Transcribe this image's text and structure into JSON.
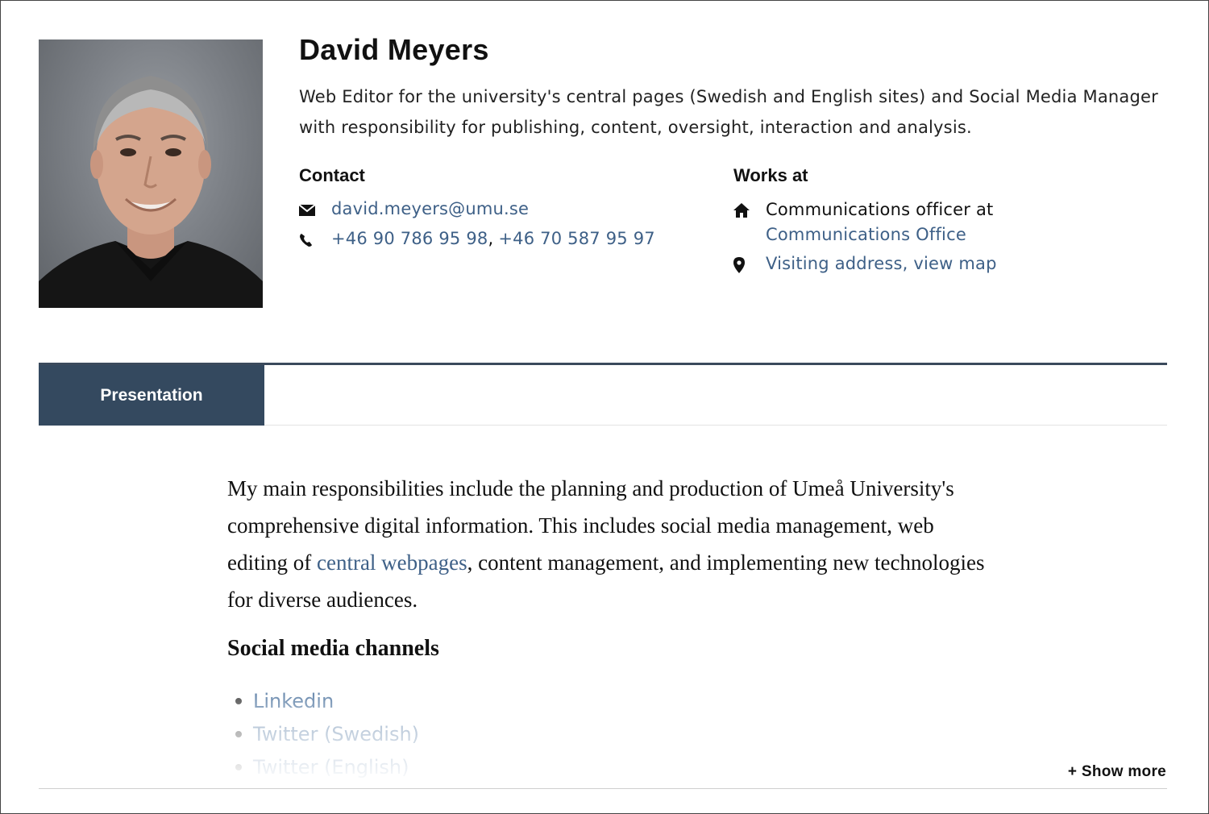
{
  "profile": {
    "name": "David Meyers",
    "role": "Web Editor for the university's central pages (Swedish and English sites) and Social Media Manager with responsibility for publishing, content, oversight, interaction and analysis.",
    "photo_icon": "portrait-photo"
  },
  "contact": {
    "heading": "Contact",
    "email": "david.meyers@umu.se",
    "email_icon": "envelope-icon",
    "phone_1": "+46 90 786 95 98",
    "phone_sep": ",",
    "phone_2": "+46 70 587 95 97",
    "phone_icon": "phone-icon"
  },
  "works_at": {
    "heading": "Works at",
    "position_text": "Communications officer at",
    "department": "Communications Office",
    "home_icon": "home-icon",
    "address_link": "Visiting address, view map",
    "pin_icon": "map-pin-icon"
  },
  "tabs": {
    "presentation": "Presentation"
  },
  "presentation": {
    "para_before": "My main responsibilities include the planning and production of Umeå University's comprehensive digital information. This includes social media management, web editing of ",
    "para_link": "central webpages",
    "para_after": ", content management, and implementing new technologies for diverse audiences.",
    "social_heading": "Social media channels",
    "social_items": [
      "Linkedin",
      "Twitter (Swedish)",
      "Twitter (English)"
    ]
  },
  "show_more": "+ Show more",
  "colors": {
    "link": "#3e6087",
    "tab_bg": "#34495f",
    "tab_rule": "#3b4a5c"
  }
}
